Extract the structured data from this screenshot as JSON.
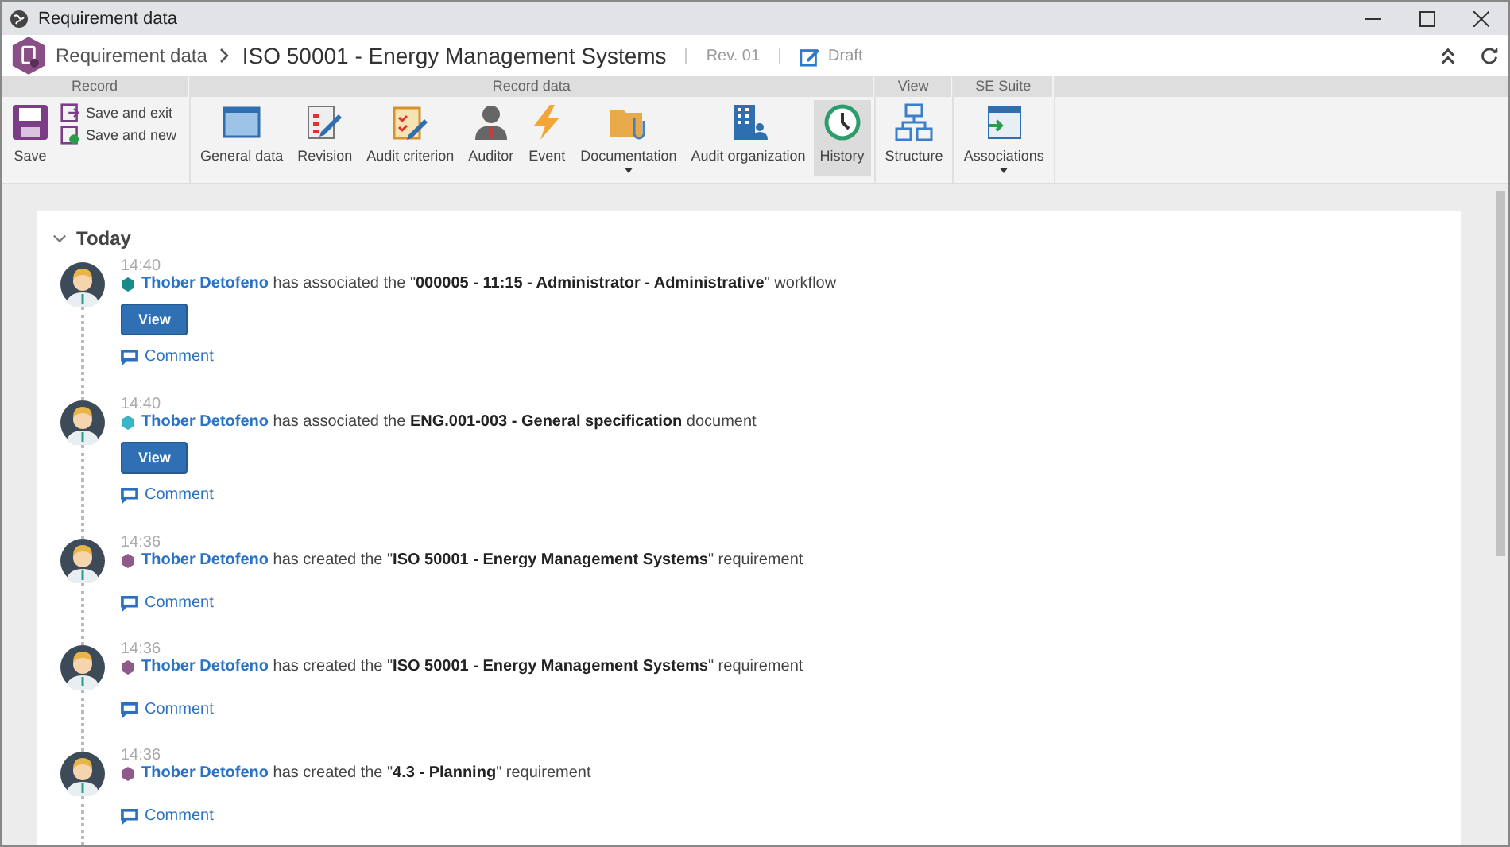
{
  "window": {
    "title": "Requirement data"
  },
  "header": {
    "breadcrumb": "Requirement data",
    "title": "ISO 50001 - Energy Management Systems",
    "revision": "Rev. 01",
    "status": "Draft"
  },
  "ribbon": [
    {
      "title": "Record",
      "kind": "record",
      "main": {
        "label": "Save"
      },
      "small": [
        {
          "label": "Save and exit"
        },
        {
          "label": "Save and new"
        }
      ]
    },
    {
      "title": "Record data",
      "kind": "tools",
      "buttons": [
        {
          "label": "General data",
          "kind": "window",
          "selected": false,
          "dropdown": false
        },
        {
          "label": "Revision",
          "kind": "revision",
          "selected": false,
          "dropdown": false
        },
        {
          "label": "Audit criterion",
          "kind": "clipboard",
          "selected": false,
          "dropdown": false
        },
        {
          "label": "Auditor",
          "kind": "person",
          "selected": false,
          "dropdown": false
        },
        {
          "label": "Event",
          "kind": "bolt",
          "selected": false,
          "dropdown": false
        },
        {
          "label": "Documentation",
          "kind": "folder",
          "selected": false,
          "dropdown": true
        },
        {
          "label": "Audit organization",
          "kind": "building",
          "selected": false,
          "dropdown": false
        },
        {
          "label": "History",
          "kind": "clock",
          "selected": true,
          "dropdown": false
        }
      ]
    },
    {
      "title": "View",
      "kind": "tools",
      "buttons": [
        {
          "label": "Structure",
          "kind": "tree",
          "selected": false,
          "dropdown": false
        }
      ]
    },
    {
      "title": "SE Suite",
      "kind": "tools",
      "buttons": [
        {
          "label": "Associations",
          "kind": "assoc",
          "selected": false,
          "dropdown": true
        }
      ]
    }
  ],
  "timeline": {
    "section": "Today",
    "expanded": true,
    "events": [
      {
        "time": "14:40",
        "color": "#1a8a8a",
        "author": "Thober Detofeno",
        "text": " has associated the \"**000005 - 11:15 - Administrator - Administrative**\" workflow",
        "button": "View",
        "comment": "Comment"
      },
      {
        "time": "14:40",
        "color": "#3ab5c8",
        "author": "Thober Detofeno",
        "text": " has associated the **ENG.001-003 - General specification** document",
        "button": "View",
        "comment": "Comment"
      },
      {
        "time": "14:36",
        "color": "#8e5a8a",
        "author": "Thober Detofeno",
        "text": " has created the \"**ISO 50001 - Energy Management Systems**\" requirement",
        "comment": "Comment"
      },
      {
        "time": "14:36",
        "color": "#8e5a8a",
        "author": "Thober Detofeno",
        "text": " has created the \"**ISO 50001 - Energy Management Systems**\" requirement",
        "comment": "Comment"
      },
      {
        "time": "14:36",
        "color": "#8e5a8a",
        "author": "Thober Detofeno",
        "text": " has created the \"**4.3 - Planning**\" requirement",
        "comment": "Comment"
      }
    ]
  }
}
